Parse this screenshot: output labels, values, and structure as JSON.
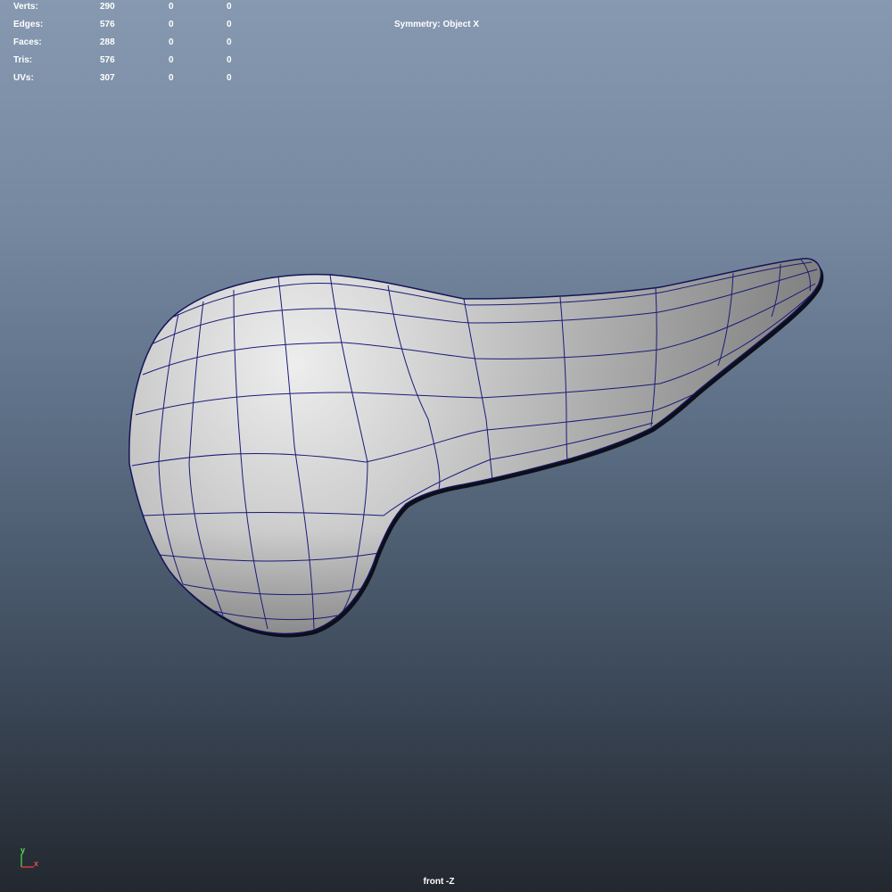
{
  "hud": {
    "stats": [
      {
        "label": "Verts:",
        "v1": "290",
        "v2": "0",
        "v3": "0"
      },
      {
        "label": "Edges:",
        "v1": "576",
        "v2": "0",
        "v3": "0"
      },
      {
        "label": "Faces:",
        "v1": "288",
        "v2": "0",
        "v3": "0"
      },
      {
        "label": "Tris:",
        "v1": "576",
        "v2": "0",
        "v3": "0"
      },
      {
        "label": "UVs:",
        "v1": "307",
        "v2": "0",
        "v3": "0"
      }
    ],
    "symmetry": "Symmetry: Object X"
  },
  "camera": {
    "label": "front -Z"
  },
  "axis": {
    "y_label": "y",
    "x_label": "x",
    "y_color": "#3ec23e",
    "x_color": "#d63a3a"
  },
  "colors": {
    "wireframe": "#1a1a7a",
    "surface": "#c4c4c4"
  },
  "object": {
    "type": "polygon-mesh"
  }
}
